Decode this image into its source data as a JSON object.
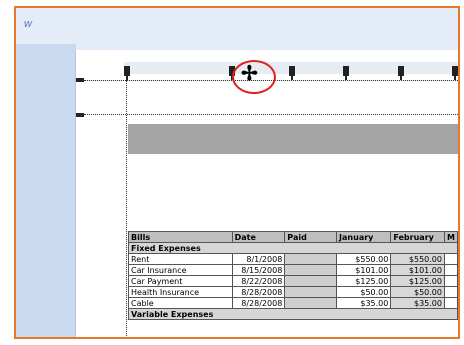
{
  "app": {
    "view_label": "w"
  },
  "table": {
    "headers": [
      "Bills",
      "Date",
      "Paid",
      "January",
      "February",
      "M"
    ],
    "sections": [
      {
        "title": "Fixed Expenses",
        "rows": [
          {
            "bill": "Rent",
            "date": "8/1/2008",
            "paid": "",
            "january": "$550.00",
            "february": "$550.00"
          },
          {
            "bill": "Car Insurance",
            "date": "8/15/2008",
            "paid": "",
            "january": "$101.00",
            "february": "$101.00"
          },
          {
            "bill": "Car Payment",
            "date": "8/22/2008",
            "paid": "",
            "january": "$125.00",
            "february": "$125.00"
          },
          {
            "bill": "Health Insurance",
            "date": "8/28/2008",
            "paid": "",
            "january": "$50.00",
            "february": "$50.00"
          },
          {
            "bill": "Cable",
            "date": "8/28/2008",
            "paid": "",
            "january": "$35.00",
            "february": "$35.00"
          }
        ]
      },
      {
        "title": "Variable Expenses",
        "rows": []
      }
    ]
  },
  "colors": {
    "highlight_ring": "#e0201b",
    "frame_border": "#e8762b",
    "header_band": "#a4a4a4"
  },
  "cursor": {
    "icon": "move-cursor-icon"
  }
}
